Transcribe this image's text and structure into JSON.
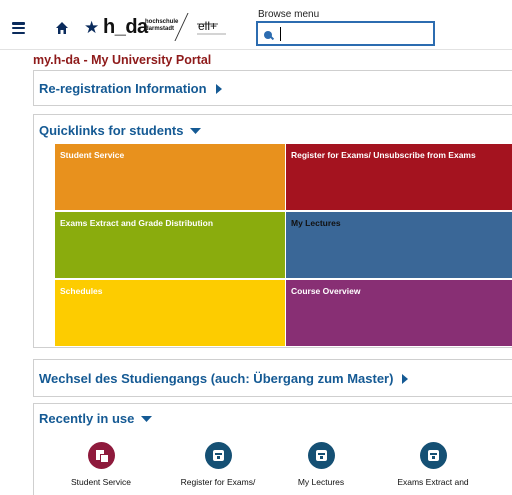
{
  "header": {
    "logo_text": "h_da",
    "logo_sub_line1": "hochschule",
    "logo_sub_line2": "darmstadt",
    "partner_logo": "ell+",
    "menu_label": "Browse menu",
    "menu_search_value": "",
    "menu_search_placeholder": ""
  },
  "portal": {
    "title": "my.h-da - My University Portal"
  },
  "sections": {
    "reregistration": {
      "title": "Re-registration Information"
    },
    "quicklinks": {
      "title": "Quicklinks for students",
      "tiles": [
        {
          "label": "Student Service",
          "color": "#e8911d"
        },
        {
          "label": "Register for Exams/ Unsubscribe from Exams",
          "color": "#a4131f"
        },
        {
          "label": "Exams Extract and Grade Distribution",
          "color": "#8aac0d"
        },
        {
          "label": "My Lectures",
          "color": "#3a6797"
        },
        {
          "label": "Schedules",
          "color": "#fdcc00"
        },
        {
          "label": "Course Overview",
          "color": "#882f74"
        }
      ]
    },
    "wechsel": {
      "title": "Wechsel des Studiengangs (auch: Übergang zum Master)"
    },
    "recent": {
      "title": "Recently in use",
      "items": [
        {
          "label": "Student Service",
          "color": "#8e1a3c"
        },
        {
          "label": "Register for Exams/",
          "color": "#155074"
        },
        {
          "label": "My Lectures",
          "color": "#155074"
        },
        {
          "label": "Exams Extract and",
          "color": "#155074"
        }
      ]
    }
  }
}
